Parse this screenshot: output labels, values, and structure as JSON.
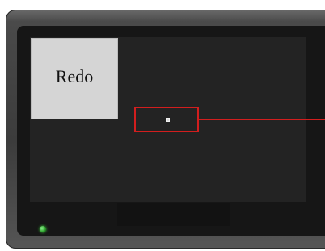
{
  "screen": {
    "redo_label": "Redo"
  },
  "colors": {
    "highlight": "#d21e1e",
    "screen_background": "#232323",
    "button_background": "#d5d5d5",
    "power_led": "#2aa02a"
  },
  "icons": {
    "power_led": "power-led-icon"
  }
}
